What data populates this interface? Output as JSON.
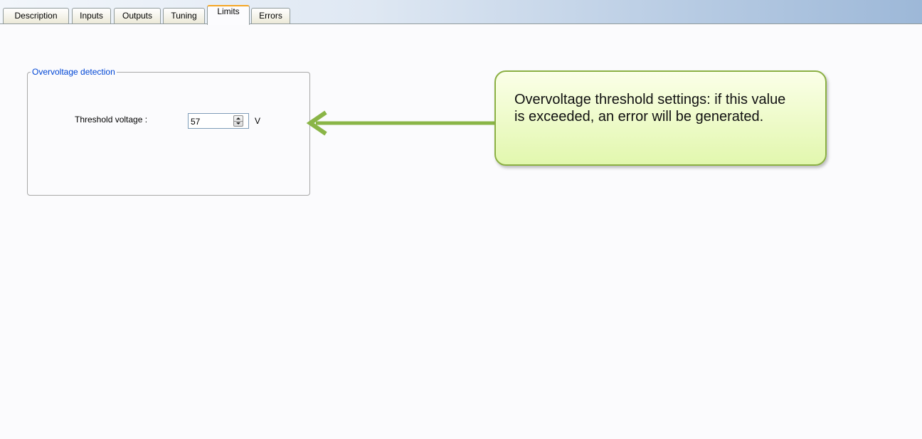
{
  "tabs": [
    {
      "label": "Description"
    },
    {
      "label": "Inputs"
    },
    {
      "label": "Outputs"
    },
    {
      "label": "Tuning"
    },
    {
      "label": "Limits",
      "active": true
    },
    {
      "label": "Errors"
    }
  ],
  "overvoltage": {
    "group_title": "Overvoltage detection",
    "threshold_label": "Threshold voltage :",
    "threshold_value": "57",
    "unit": "V"
  },
  "callout": {
    "text": "Overvoltage threshold settings: if this value is exceeded, an error will be generated."
  },
  "colors": {
    "group_title": "#0046d5",
    "callout_border": "#8bb044",
    "callout_fill": "#e2f7ae",
    "arrow": "#8ab547",
    "active_tab_accent": "#f5a623"
  },
  "icons": [
    "arrow-left-icon",
    "spinner-up-icon",
    "spinner-down-icon"
  ]
}
